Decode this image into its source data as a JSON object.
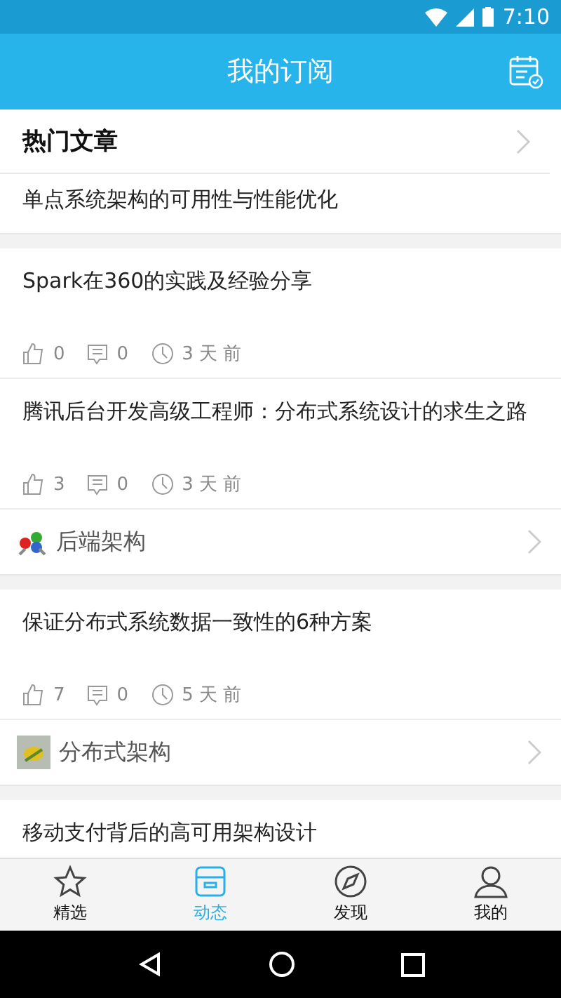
{
  "status_bar": {
    "time": "7:10"
  },
  "app_bar": {
    "title": "我的订阅"
  },
  "hot": {
    "title": "热门文章",
    "article": "单点系统架构的可用性与性能优化"
  },
  "groups": [
    {
      "articles": [
        {
          "title": "Spark在360的实践及经验分享",
          "likes": "0",
          "comments": "0",
          "time": "3 天 前"
        },
        {
          "title": "腾讯后台开发高级工程师：分布式系统设计的求生之路",
          "likes": "3",
          "comments": "0",
          "time": "3 天 前"
        }
      ],
      "category": {
        "name": "后端架构",
        "kind": "gears"
      }
    },
    {
      "articles": [
        {
          "title": "保证分布式系统数据一致性的6种方案",
          "likes": "7",
          "comments": "0",
          "time": "5 天 前"
        }
      ],
      "category": {
        "name": "分布式架构",
        "kind": "photo"
      }
    },
    {
      "articles": [
        {
          "title": "移动支付背后的高可用架构设计"
        }
      ]
    }
  ],
  "tabs": [
    {
      "label": "精选",
      "kind": "star",
      "selected": false
    },
    {
      "label": "动态",
      "kind": "box",
      "selected": true
    },
    {
      "label": "发现",
      "kind": "compass",
      "selected": false
    },
    {
      "label": "我的",
      "kind": "user",
      "selected": false
    }
  ]
}
